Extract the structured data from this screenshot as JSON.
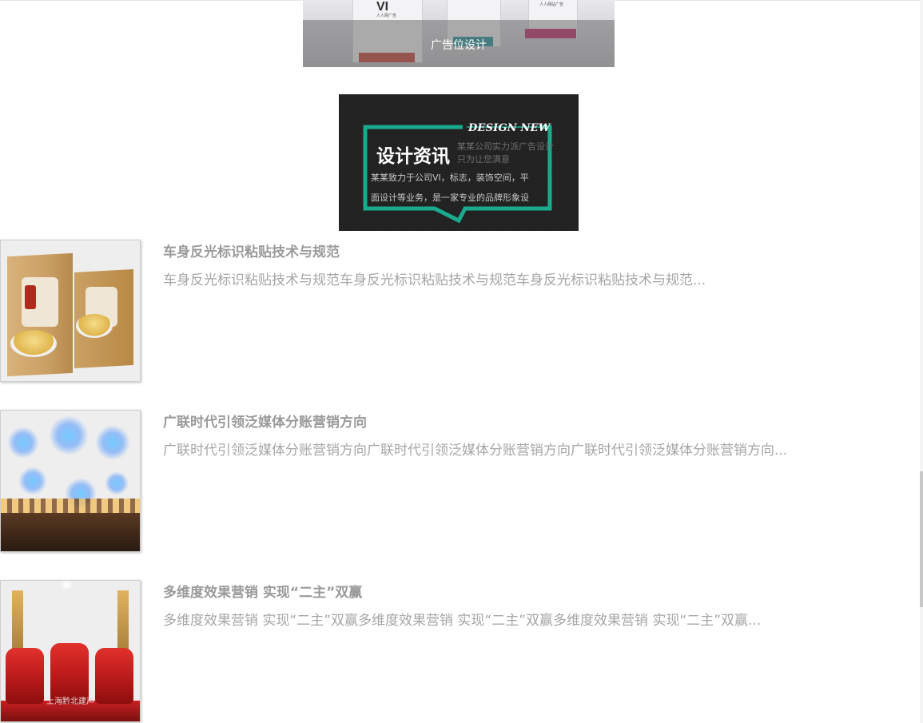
{
  "ad_card": {
    "caption": "广告位设计",
    "brand_mark": "VI",
    "tiny_text_1": "人人网广告",
    "tiny_text_2": "人人网站广告"
  },
  "news_banner": {
    "en_title": "DESIGN NEW",
    "cn_title": "设计资讯",
    "subtitle_1": "某某公司实力派广告设计",
    "subtitle_2": "只为让您满意",
    "desc_line_1": "某某致力于公司VI，标志，装饰空间，平",
    "desc_line_2": "面设计等业务，是一家专业的品牌形象设",
    "accent_color": "#1aaa8e"
  },
  "articles": [
    {
      "title": "车身反光标识粘贴技术与规范",
      "summary": "车身反光标识粘贴技术与规范车身反光标识粘贴技术与规范车身反光标识粘贴技术与规范..."
    },
    {
      "title": "广联时代引领泛媒体分账营销方向",
      "summary": "广联时代引领泛媒体分账营销方向广联时代引领泛媒体分账营销方向广联时代引领泛媒体分账营销方向..."
    },
    {
      "title": "多维度效果营销 实现“二主”双赢",
      "summary": "多维度效果营销 实现“二主”双赢多维度效果营销 实现“二主”双赢多维度效果营销 实现“二主”双赢...",
      "thumb_caption": "上海黔北建声"
    }
  ],
  "colors": {
    "title_gray": "#9a9a9a",
    "summary_gray": "#a6a6a6",
    "banner_bg": "#222222"
  }
}
